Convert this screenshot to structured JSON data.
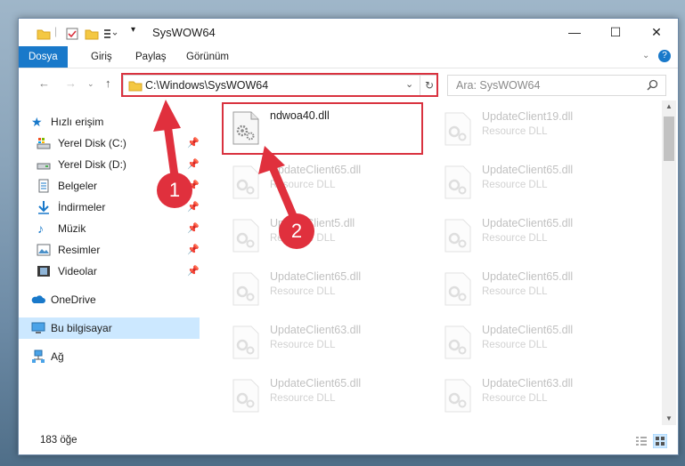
{
  "window": {
    "title": "SysWOW64",
    "minimize": "—",
    "maximize": "☐",
    "close": "✕"
  },
  "ribbon": {
    "tabs": [
      "Dosya",
      "Giriş",
      "Paylaş",
      "Görünüm"
    ],
    "help": "?"
  },
  "address": {
    "path": "C:\\Windows\\SysWOW64",
    "search_placeholder": "Ara: SysWOW64"
  },
  "nav": {
    "quick_access": "Hızlı erişim",
    "items": [
      {
        "label": "Yerel Disk (C:)",
        "pinned": true
      },
      {
        "label": "Yerel Disk (D:)",
        "pinned": true
      },
      {
        "label": "Belgeler",
        "pinned": true
      },
      {
        "label": "İndirmeler",
        "pinned": true
      },
      {
        "label": "Müzik",
        "pinned": true
      },
      {
        "label": "Resimler",
        "pinned": true
      },
      {
        "label": "Videolar",
        "pinned": true
      }
    ],
    "onedrive": "OneDrive",
    "this_pc": "Bu bilgisayar",
    "network": "Ağ"
  },
  "files": {
    "left": [
      {
        "name": "ndwoa40.dll",
        "type": ""
      },
      {
        "name": "UpdateClient65.dll",
        "type": "Resource DLL"
      },
      {
        "name": "UpdateClient5.dll",
        "type": "Resource DLL"
      },
      {
        "name": "UpdateClient65.dll",
        "type": "Resource DLL"
      },
      {
        "name": "UpdateClient63.dll",
        "type": "Resource DLL"
      },
      {
        "name": "UpdateClient65.dll",
        "type": "Resource DLL"
      }
    ],
    "right": [
      {
        "name": "UpdateClient19.dll",
        "type": "Resource DLL"
      },
      {
        "name": "UpdateClient65.dll",
        "type": "Resource DLL"
      },
      {
        "name": "UpdateClient65.dll",
        "type": "Resource DLL"
      },
      {
        "name": "UpdateClient65.dll",
        "type": "Resource DLL"
      },
      {
        "name": "UpdateClient65.dll",
        "type": "Resource DLL"
      },
      {
        "name": "UpdateClient63.dll",
        "type": "Resource DLL"
      }
    ]
  },
  "status": {
    "count": "183 öğe"
  },
  "annotations": {
    "badge1": "1",
    "badge2": "2",
    "color": "#e0303d"
  }
}
